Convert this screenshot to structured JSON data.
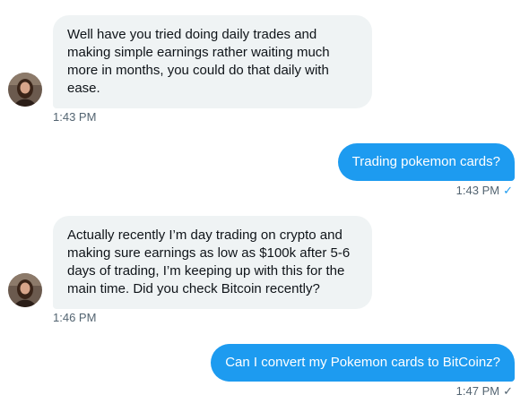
{
  "messages": [
    {
      "direction": "incoming",
      "text": "Well have you tried doing daily trades and making simple earnings rather waiting much more in months, you could do that daily with ease.",
      "time": "1:43 PM"
    },
    {
      "direction": "outgoing",
      "text": "Trading pokemon cards?",
      "time": "1:43 PM",
      "status_icon": "check-icon",
      "status_color": "#1d9bf0"
    },
    {
      "direction": "incoming",
      "text": "Actually recently I’m day trading on crypto and making sure earnings as low as $100k after 5-6 days of trading, I’m keeping up with this for the main time. Did you check Bitcoin recently?",
      "time": "1:46 PM"
    },
    {
      "direction": "outgoing",
      "text": "Can I convert my Pokemon cards to BitCoinz?",
      "time": "1:47 PM",
      "status_icon": "check-icon",
      "status_color": "#536471"
    }
  ],
  "colors": {
    "accent": "#1d9bf0",
    "incoming_bg": "#eff3f4",
    "muted": "#536471"
  }
}
